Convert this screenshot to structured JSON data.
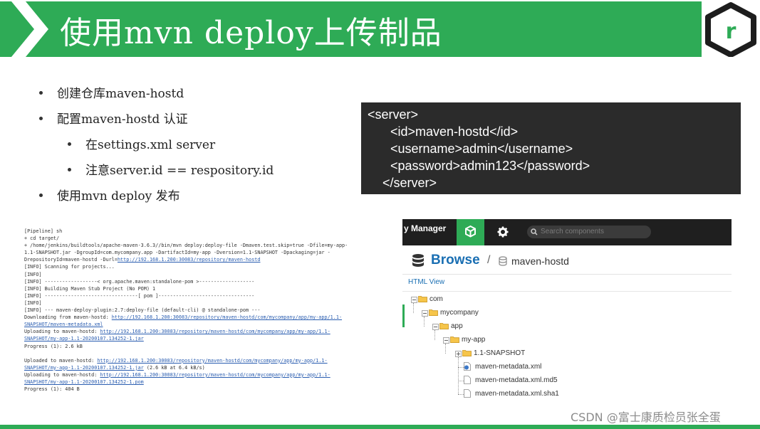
{
  "header": {
    "title": "使用mvn deploy上传制品",
    "logo_letter": "r",
    "brand_color": "#2eab56"
  },
  "bullets": [
    {
      "text": "创建仓库maven-hostd",
      "level": 1
    },
    {
      "text": "配置maven-hostd 认证",
      "level": 1
    },
    {
      "text": "在settings.xml server",
      "level": 2
    },
    {
      "text": "注意server.id == respository.id",
      "level": 2
    },
    {
      "text": "使用mvn deploy 发布",
      "level": 1
    }
  ],
  "code_block": {
    "lines": [
      "<server>",
      "<id>maven-hostd</id>",
      "<username>admin</username>",
      "<password>admin123</password>",
      "</server>"
    ]
  },
  "console": {
    "lines": [
      {
        "text": "[Pipeline] sh"
      },
      {
        "text": "+ cd target/"
      },
      {
        "text": "+ /home/jenkins/buildtools/apache-maven-3.6.3//bin/mvn deploy:deploy-file -Dmaven.test.skip=true -Dfile=my-app-"
      },
      {
        "text": "1.1-SNAPSHOT.jar -DgroupId=com.mycompany.app -DartifactId=my-app -Dversion=1.1-SNAPSHOT -Dpackaging=jar -"
      },
      {
        "text": "DrepositoryId=maven-hostd -Durl=",
        "link": "http://192.168.1.200:30083/repository/maven-hostd"
      },
      {
        "text": "[INFO] Scanning for projects..."
      },
      {
        "text": "[INFO]"
      },
      {
        "text": "[INFO] ------------------< org.apache.maven:standalone-pom >-------------------"
      },
      {
        "text": "[INFO] Building Maven Stub Project (No POM) 1"
      },
      {
        "text": "[INFO] --------------------------------[ pom ]---------------------------------"
      },
      {
        "text": "[INFO]"
      },
      {
        "text": "[INFO] --- maven-deploy-plugin:2.7:deploy-file (default-cli) @ standalone-pom ---"
      },
      {
        "text": "Downloading from maven-hostd: ",
        "link": "http://192.168.1.200:30083/repository/maven-hostd/com/mycompany/app/my-app/1.1-"
      },
      {
        "text": "",
        "link": "SNAPSHOT/maven-metadata.xml"
      },
      {
        "text": "Uploading to maven-hostd: ",
        "link": "http://192.168.1.200:30083/repository/maven-hostd/com/mycompany/app/my-app/1.1-"
      },
      {
        "text": "",
        "link": "SNAPSHOT/my-app-1.1-20200107.134252-1.jar"
      },
      {
        "text": "Progress (1): 2.6 kB"
      },
      {
        "text": ""
      },
      {
        "text": "Uploaded to maven-hostd: ",
        "link": "http://192.168.1.200:30083/repository/maven-hostd/com/mycompany/app/my-app/1.1-"
      },
      {
        "text": "",
        "link": "SNAPSHOT/my-app-1.1-20200107.134252-1.jar",
        "tail": " (2.6 kB at 6.4 kB/s)"
      },
      {
        "text": "Uploading to maven-hostd: ",
        "link": "http://192.168.1.200:30083/repository/maven-hostd/com/mycompany/app/my-app/1.1-"
      },
      {
        "text": "",
        "link": "SNAPSHOT/my-app-1.1-20200107.134252-1.pom"
      },
      {
        "text": "Progress (1): 404 B"
      }
    ]
  },
  "nexus": {
    "app_title": "y Manager",
    "search_placeholder": "Search components",
    "browse_title": "Browse",
    "breadcrumb_sep": "/",
    "repo_name": "maven-hostd",
    "html_view": "HTML View",
    "tree": [
      {
        "label": "com",
        "depth": 0,
        "kind": "folder"
      },
      {
        "label": "mycompany",
        "depth": 1,
        "kind": "folder"
      },
      {
        "label": "app",
        "depth": 2,
        "kind": "folder"
      },
      {
        "label": "my-app",
        "depth": 3,
        "kind": "folder"
      },
      {
        "label": "1.1-SNAPSHOT",
        "depth": 4,
        "kind": "folder-collapsed"
      },
      {
        "label": "maven-metadata.xml",
        "depth": 4,
        "kind": "file-xml"
      },
      {
        "label": "maven-metadata.xml.md5",
        "depth": 4,
        "kind": "file"
      },
      {
        "label": "maven-metadata.xml.sha1",
        "depth": 4,
        "kind": "file"
      }
    ]
  },
  "watermark": "CSDN @富士康质检员张全蛋"
}
